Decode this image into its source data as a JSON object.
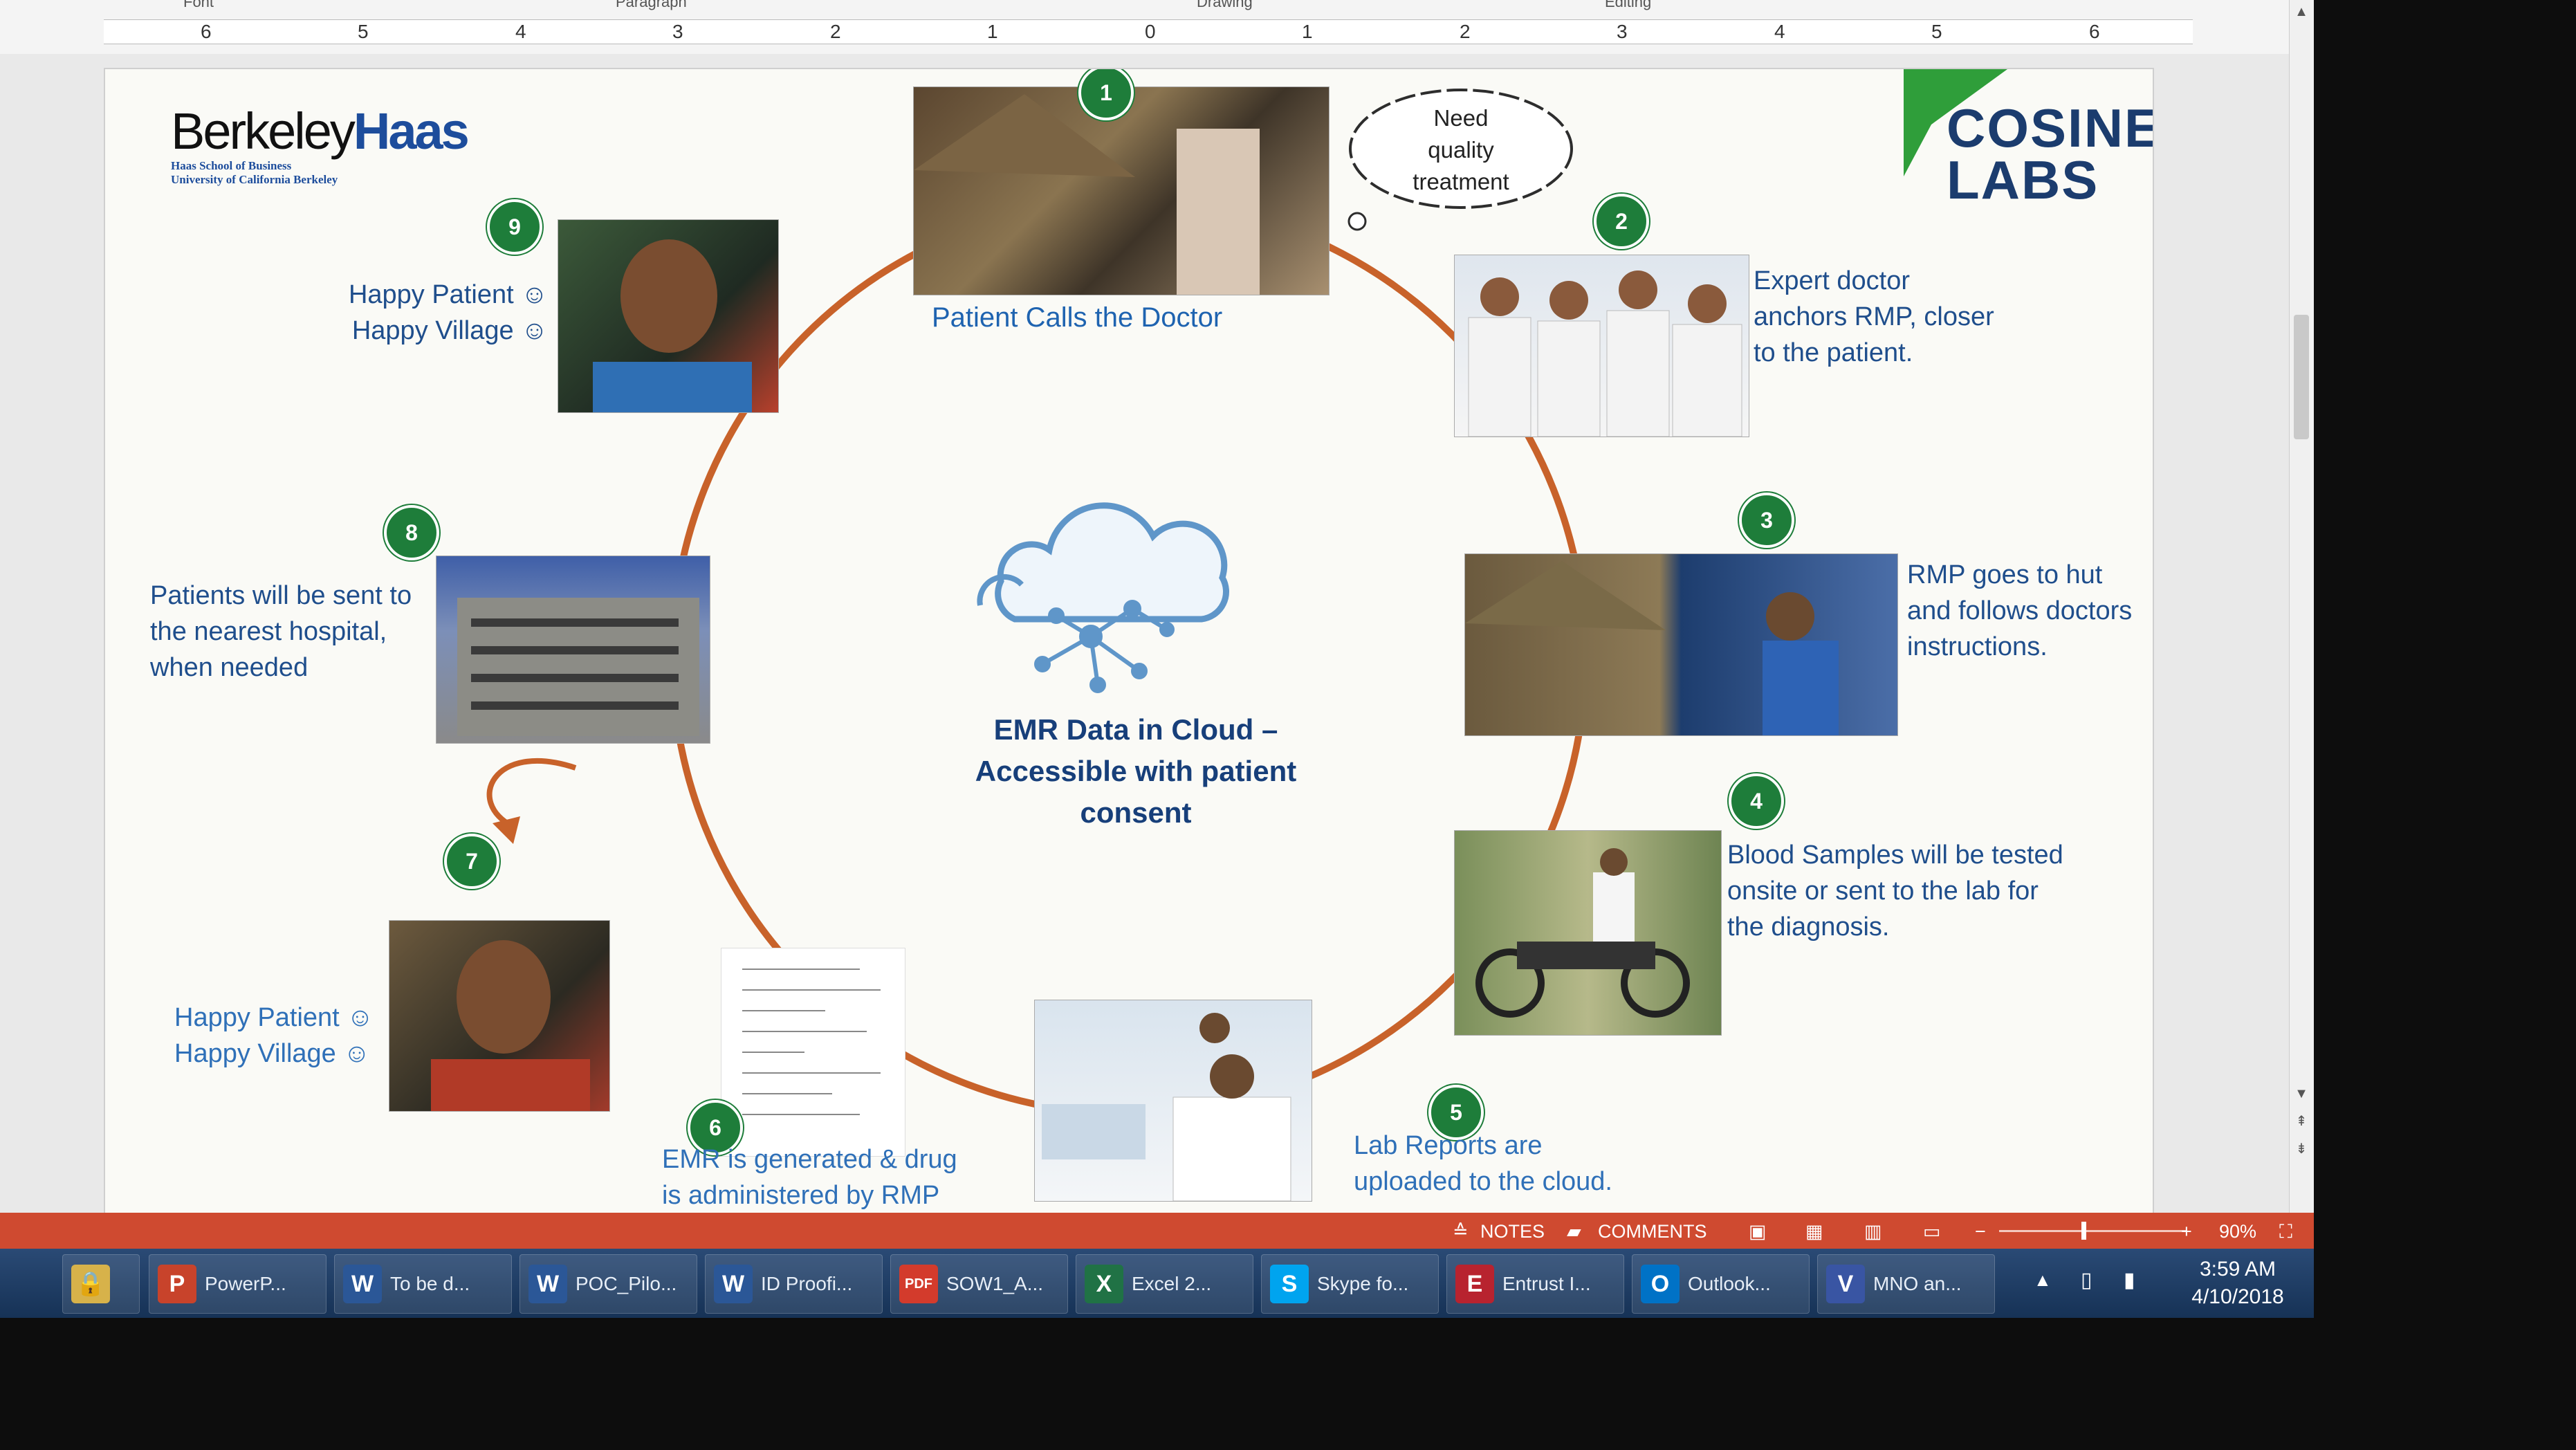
{
  "ruler": {
    "groups": [
      "Font",
      "Paragraph",
      "Drawing",
      "Editing"
    ],
    "numbers": [
      "6",
      "5",
      "4",
      "3",
      "2",
      "1",
      "0",
      "1",
      "2",
      "3",
      "4",
      "5",
      "6"
    ]
  },
  "slide": {
    "logo_left": {
      "brand_a": "Berkeley",
      "brand_b": "Haas",
      "line1": "Haas School of Business",
      "line2": "University of California Berkeley"
    },
    "logo_right": {
      "line1": "COSINE",
      "line2": "LABS"
    },
    "thought_bubble": [
      "Need",
      "quality",
      "treatment"
    ],
    "center": [
      "EMR Data in Cloud –",
      "Accessible with patient",
      "consent"
    ],
    "steps": [
      {
        "n": "1",
        "text": [
          "Patient Calls the Doctor"
        ]
      },
      {
        "n": "2",
        "text": [
          "Expert doctor",
          "anchors RMP, closer",
          "to the patient."
        ]
      },
      {
        "n": "3",
        "text": [
          "RMP goes to hut",
          "and follows doctors",
          "instructions."
        ]
      },
      {
        "n": "4",
        "text": [
          "Blood Samples will be tested",
          "onsite or sent to the lab for",
          "the diagnosis."
        ]
      },
      {
        "n": "5",
        "text": [
          "Lab Reports are",
          "uploaded to the cloud."
        ]
      },
      {
        "n": "6",
        "text": [
          "EMR is generated & drug",
          "is administered by RMP"
        ]
      },
      {
        "n": "7",
        "text": [
          "Happy Patient ☺",
          "Happy Village ☺"
        ]
      },
      {
        "n": "8",
        "text": [
          "Patients will be sent to",
          "the nearest hospital,",
          "when needed"
        ]
      },
      {
        "n": "9",
        "text": [
          "Happy Patient ☺",
          "Happy Village ☺"
        ]
      }
    ]
  },
  "statusbar": {
    "notes": "NOTES",
    "comments": "COMMENTS",
    "zoom": "90%",
    "zoom_fraction": 0.45
  },
  "taskbar": {
    "items": [
      {
        "icon": "P",
        "label": "PowerP...",
        "color": "#c8432b"
      },
      {
        "icon": "W",
        "label": "To be d...",
        "color": "#2b5797"
      },
      {
        "icon": "W",
        "label": "POC_Pilo...",
        "color": "#2b5797"
      },
      {
        "icon": "W",
        "label": "ID Proofi...",
        "color": "#2b5797"
      },
      {
        "icon": "PDF",
        "label": "SOW1_A...",
        "color": "#d33b2c"
      },
      {
        "icon": "X",
        "label": "Excel 2...",
        "color": "#207245"
      },
      {
        "icon": "S",
        "label": "Skype fo...",
        "color": "#00a4ef"
      },
      {
        "icon": "E",
        "label": "Entrust I...",
        "color": "#b8232f"
      },
      {
        "icon": "O",
        "label": "Outlook...",
        "color": "#0072c6"
      },
      {
        "icon": "V",
        "label": "MNO an...",
        "color": "#3955a3"
      }
    ],
    "time": "3:59 AM",
    "date": "4/10/2018"
  },
  "colors": {
    "accent": "#cf4a30",
    "badge": "#1e7d3a",
    "text_blue": "#1f4e8c",
    "ring": "#c8622a"
  }
}
